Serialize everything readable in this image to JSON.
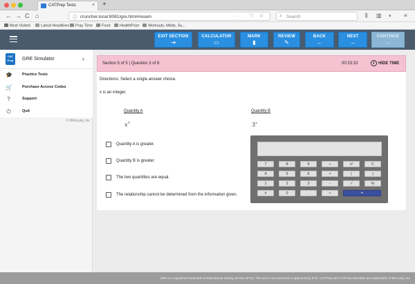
{
  "browser": {
    "tab_title": "CATPrep Tests",
    "tab_close": "×",
    "new_tab": "+",
    "back": "←",
    "forward": "→",
    "reload": "C",
    "home": "⌂",
    "url": "cruncher.local:8081/gre.html#/exam",
    "url_actions": "··· ♡ ☆",
    "search_placeholder": "Search",
    "bookmarks": [
      {
        "label": "Most Visited",
        "color": "#6d6d6d"
      },
      {
        "label": "Latest Headlines",
        "color": "#9a9a9a"
      },
      {
        "label": "Pray Time",
        "color": "#8a8a8a"
      },
      {
        "label": "Food",
        "color": "#8a8a8a"
      },
      {
        "label": "HealthPrize",
        "color": "#8a8a8a"
      },
      {
        "label": "Workouts, Mbds, Su...",
        "color": "#8a8a8a"
      }
    ]
  },
  "toolbar": {
    "exit_section": {
      "label": "EXIT SECTION",
      "icon": "⇥"
    },
    "calculator": {
      "label": "CALCULATOR",
      "icon": "▭"
    },
    "mark": {
      "label": "MARK",
      "icon": "▮"
    },
    "review": {
      "label": "REVIEW",
      "icon": "✎"
    },
    "back": {
      "label": "BACK",
      "icon": "←"
    },
    "next": {
      "label": "NEXT",
      "icon": "→"
    },
    "continue": {
      "label": "CONTINUE",
      "icon": "→"
    }
  },
  "sidebar": {
    "logo_line1": "CAT",
    "logo_line2": "Prep",
    "title": "GRE Simulator",
    "collapse": "‹",
    "items": [
      {
        "label": "Practice Tests",
        "icon": "🎓"
      },
      {
        "label": "Purchase Access Codes",
        "icon": "🛒"
      },
      {
        "label": "Support",
        "icon": "?"
      },
      {
        "label": "Quit",
        "icon": "⏻"
      }
    ],
    "copyright": "© BKAcuity, Inc"
  },
  "question": {
    "progress": "Section 5 of 5 | Question 3 of 8",
    "timer": "00:23:10",
    "hide_time": "HIDE TIME",
    "directions": "Directions: Select a single answer choice.",
    "stem": "x is an integer.",
    "quantity_a_label": "Quantity A",
    "quantity_b_label": "Quantity B",
    "quantity_a_base": "x",
    "quantity_a_exp": "3",
    "quantity_b_base": "3",
    "quantity_b_exp": "x",
    "options": [
      "Quantity A is greater.",
      "Quantity B is greater.",
      "The two quantities are equal.",
      "The relationship cannot be determined from the information given."
    ]
  },
  "calculator": {
    "keys": [
      [
        "7",
        "8",
        "9",
        "÷",
        "x²",
        "C"
      ],
      [
        "4",
        "5",
        "6",
        "×",
        "(",
        ")"
      ],
      [
        "1",
        "2",
        "3",
        "-",
        "√",
        "%"
      ],
      [
        "±",
        "0",
        ".",
        "+",
        "="
      ]
    ]
  },
  "footer": {
    "text": "GRE is a registered trademark of Educational Testing Service (ETS). This test is not endorsed or approved by ETS. CATPrep and CATPrep Simulator are trademarks of BKAcuity, Inc."
  }
}
